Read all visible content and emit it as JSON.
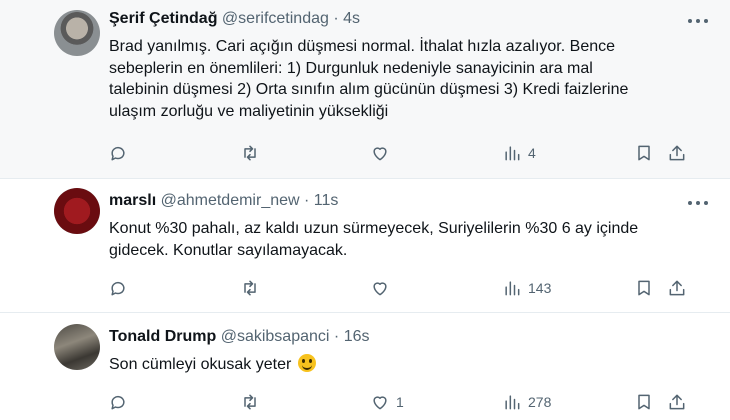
{
  "tweets": [
    {
      "author": "Şerif Çetindağ",
      "handle": "@serifcetindag",
      "time": "4s",
      "text_lines": [
        "Brad yanılmış. Cari açığın düşmesi normal. İthalat hızla azalıyor. Bence",
        "sebeplerin en önemlileri: 1) Durgunluk nedeniyle sanayicinin ara mal",
        "talebinin düşmesi 2) Orta sınıfın alım gücünün düşmesi  3) Kredi faizlerine",
        "ulaşım zorluğu ve maliyetinin yüksekliği"
      ],
      "likes": "",
      "views": "4"
    },
    {
      "author": "marslı",
      "handle": "@ahmetdemir_new",
      "time": "11s",
      "text_lines": [
        "Konut %30 pahalı, az kaldı uzun sürmeyecek, Suriyelilerin %30 6 ay içinde",
        "gidecek. Konutlar sayılamayacak."
      ],
      "likes": "",
      "views": "143"
    },
    {
      "author": "Tonald Drump",
      "handle": "@sakibsapanci",
      "time": "16s",
      "text_lines": [
        "Son cümleyi okusak yeter"
      ],
      "likes": "1",
      "views": "278"
    }
  ],
  "separator": "·",
  "icons": [
    "more-icon",
    "reply-icon",
    "retweet-icon",
    "like-icon",
    "views-icon",
    "bookmark-icon",
    "share-icon",
    "grinning-emoji"
  ],
  "colors": {
    "text": "#0f1419",
    "muted": "#536471",
    "hover_bg": "#f7f8f9",
    "divider": "#e6ecf0"
  }
}
